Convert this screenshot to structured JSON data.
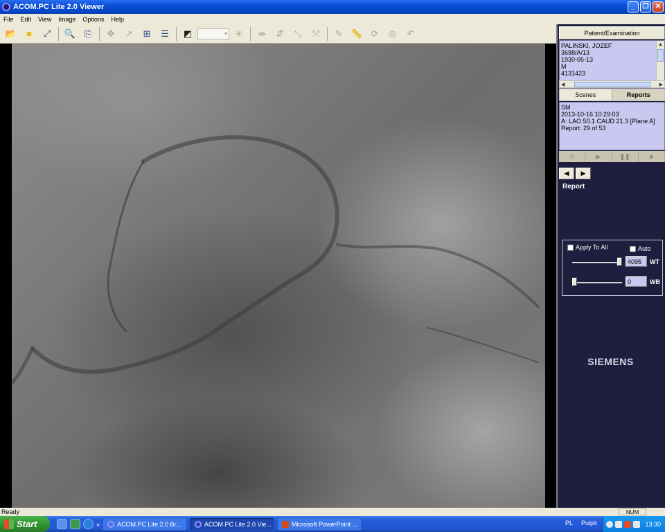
{
  "window": {
    "title": "ACOM.PC Lite 2.0 Viewer"
  },
  "menu": [
    "File",
    "Edit",
    "View",
    "Image",
    "Options",
    "Help"
  ],
  "toolbar": {
    "zoom_value": ""
  },
  "panel": {
    "header": "Patient/Examination",
    "patient": {
      "name": "PALINSKI, JOZEF",
      "id": "3698/A/13",
      "dob": "1930-05-13",
      "sex": "M",
      "number": "4131423"
    },
    "tabs": {
      "scenes": "Scenes",
      "reports": "Reports"
    },
    "report_info": {
      "line1": "SM",
      "line2": "2013-10-16 10:29:03",
      "line3": "A: LAO 50.1 CAUD 21.3  [Plane A]",
      "line4": "Report: 29 of 53"
    },
    "report_label": "Report",
    "window_level": {
      "apply_to_all": "Apply To All",
      "auto": "Auto",
      "wt_value": "4095",
      "wt_label": "WT",
      "wb_value": "0",
      "wb_label": "WB",
      "wt_slider_fraction": 1.0,
      "wb_slider_fraction": 0.0
    },
    "brand": "SIEMENS"
  },
  "status": {
    "text": "Ready",
    "num": "NUM"
  },
  "taskbar": {
    "start": "Start",
    "tasks": [
      "ACOM.PC Lite 2.0 Br...",
      "ACOM.PC Lite 2.0 Vie...",
      "Microsoft PowerPoint ..."
    ],
    "lang": "PL",
    "desk": "Pulpit",
    "clock": "13:30"
  },
  "icons": [
    "open-folder-icon",
    "folder-icon",
    "measure-icon",
    "zoom-icon",
    "export-icon",
    "layout-grid-icon",
    "list-icon",
    "window-level-icon"
  ]
}
